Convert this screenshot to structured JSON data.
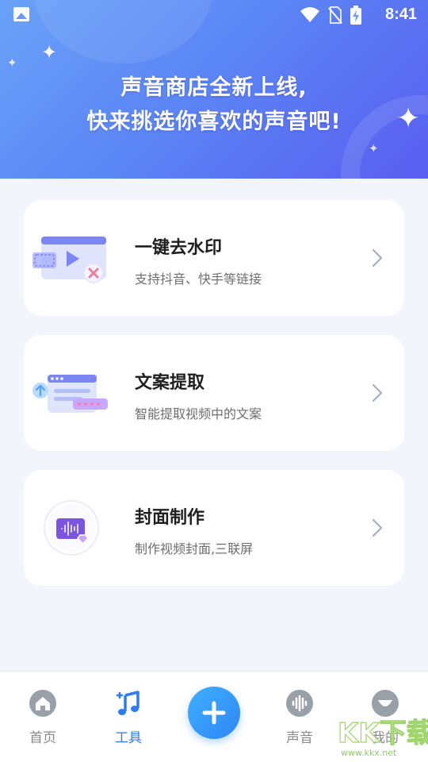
{
  "status_bar": {
    "time": "8:41",
    "icons": [
      "gallery-icon",
      "wifi-icon",
      "no-sim-icon",
      "battery-charging-icon"
    ]
  },
  "banner": {
    "line1": "声音商店全新上线,",
    "line2": "快来挑选你喜欢的声音吧!",
    "colors": [
      "#6aa2f8",
      "#5a5ef0"
    ]
  },
  "tools": [
    {
      "title": "一键去水印",
      "subtitle": "支持抖音、快手等链接",
      "icon": "video-watermark-icon"
    },
    {
      "title": "文案提取",
      "subtitle": "智能提取视频中的文案",
      "icon": "text-extract-icon"
    },
    {
      "title": "封面制作",
      "subtitle": "制作视频封面,三联屏",
      "icon": "cover-make-icon"
    }
  ],
  "bottom_nav": {
    "items": [
      {
        "label": "首页",
        "icon": "home-icon"
      },
      {
        "label": "工具",
        "icon": "music-note-icon",
        "active": true
      },
      {
        "label": "",
        "icon": "plus-icon"
      },
      {
        "label": "声音",
        "icon": "sound-wave-icon"
      },
      {
        "label": "我的",
        "icon": "profile-icon"
      }
    ],
    "active_color": "#2f7bf5"
  },
  "watermark": {
    "text": "KK下载",
    "url": "www.kkx.net"
  }
}
